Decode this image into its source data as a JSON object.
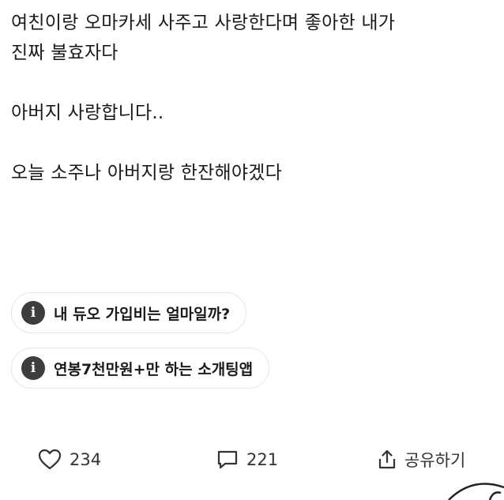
{
  "post": {
    "line1": "여친이랑 오마카세 사주고 사랑한다며 좋아한 내가",
    "line2": "진짜 불효자다",
    "para2": "아버지 사랑합니다..",
    "para3": "오늘 소주나 아버지랑 한잔해야겠다"
  },
  "ads": [
    {
      "label": "내 듀오 가입비는 얼마일까?",
      "icon": "info-icon"
    },
    {
      "label": "연봉7천만원+만 하는 소개팅앱",
      "icon": "info-icon"
    }
  ],
  "actions": {
    "like_count": "234",
    "comment_count": "221",
    "share_label": "공유하기"
  },
  "colors": {
    "text": "#1a1a1a",
    "chip_border": "#e6e6e6",
    "icon_bg": "#3d3d3d"
  }
}
